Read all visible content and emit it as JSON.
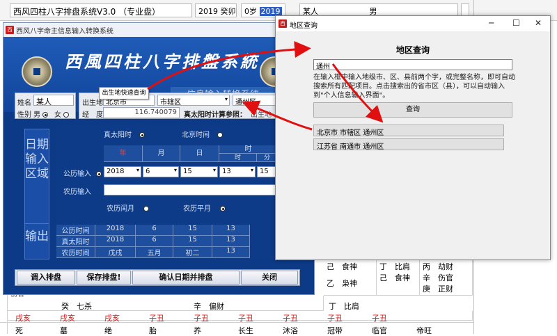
{
  "background": {
    "header": {
      "title": "西风四柱八字排盘系统V3.0 （专业盘）",
      "year": "2019 癸卯",
      "age": "0岁",
      "age_year": "2019",
      "name": "某人",
      "gender": "男"
    },
    "rows": [
      [
        "",
        "",
        "",
        "",
        "",
        "",
        "己　食神",
        "丁　比肩",
        "丙　劫财"
      ],
      [
        "",
        "",
        "",
        "",
        "",
        "",
        "",
        "己　食神",
        "辛　伤官"
      ],
      [
        "",
        "",
        "",
        "",
        "",
        "",
        "乙　枭神",
        "",
        "庚　正财"
      ]
    ],
    "hidden_stems": [
      "癸　七杀",
      "辛　偏财",
      "丁　比肩"
    ],
    "branch_row": [
      "戌亥",
      "戌亥",
      "戌亥",
      "子丑",
      "子丑",
      "子丑",
      "子丑",
      "子丑",
      "子丑"
    ],
    "stage_row": [
      "死",
      "墓",
      "绝",
      "胎",
      "养",
      "长生",
      "沐浴",
      "冠带",
      "临官",
      "帝旺"
    ],
    "left_cell": "伤官"
  },
  "left_window": {
    "title": "西风八字命主信息输入转换系统",
    "banner_title": "西風四柱八字排盤系統",
    "banner_subtitle": "信息输入转换系统",
    "name_label": "姓名",
    "name_value": "某人",
    "gender_label": "性别",
    "gender_male": "男",
    "gender_female": "女",
    "birthplace_label": "出生地",
    "birthplace_city": "北京市",
    "birthplace_district": "市辖区",
    "birthplace_county": "通州区",
    "longitude_label": "经　度",
    "longitude_value": "116.740079",
    "solar_note": "真太阳时计算参照：",
    "solar_note2": "出生地",
    "tooltip": "出生地快速查询",
    "date_side": "日期输入区域",
    "true_solar_label": "真太阳时",
    "beijing_label": "北京时间",
    "col_year": "年",
    "col_month": "月",
    "col_day": "日",
    "col_time": "时",
    "col_hour": "时",
    "col_minute": "分",
    "gregorian_label": "公历输入",
    "lunar_label": "农历输入",
    "year_value": "2018",
    "month_value": "6",
    "day_value": "15",
    "hour_value": "13",
    "minute_value": "15",
    "leap_label": "农历闰月",
    "normal_label": "农历平月",
    "output_side": "输出",
    "out_rows": [
      {
        "label": "公历时间",
        "year": "2018",
        "month": "6",
        "day": "15",
        "hour": "13"
      },
      {
        "label": "真太阳时",
        "year": "2018",
        "month": "6",
        "day": "15",
        "hour": "13"
      },
      {
        "label": "农历时间",
        "year": "戊戌",
        "month": "五月",
        "day": "初二",
        "hour": "13"
      }
    ],
    "buttons": {
      "import": "调入排盘",
      "save": "保存排盘!",
      "confirm": "确认日期并排盘",
      "close": "关闭"
    }
  },
  "region_dialog": {
    "title": "地区查询",
    "heading": "地区查询",
    "search_value": "通州",
    "instructions": "在输入框中输入地级市、区、县前两个字，或完整名称，即可自动搜索所有匹配项目。点击搜索出的省市区（县），可以自动输入到\"个人信息输入界面\"。",
    "query_button": "查询",
    "results": [
      "北京市 市辖区 通州区",
      "江苏省 南通市 通州区"
    ]
  },
  "colors": {
    "accent_red": "#d01818",
    "panel_blue": "#0c3a86"
  }
}
